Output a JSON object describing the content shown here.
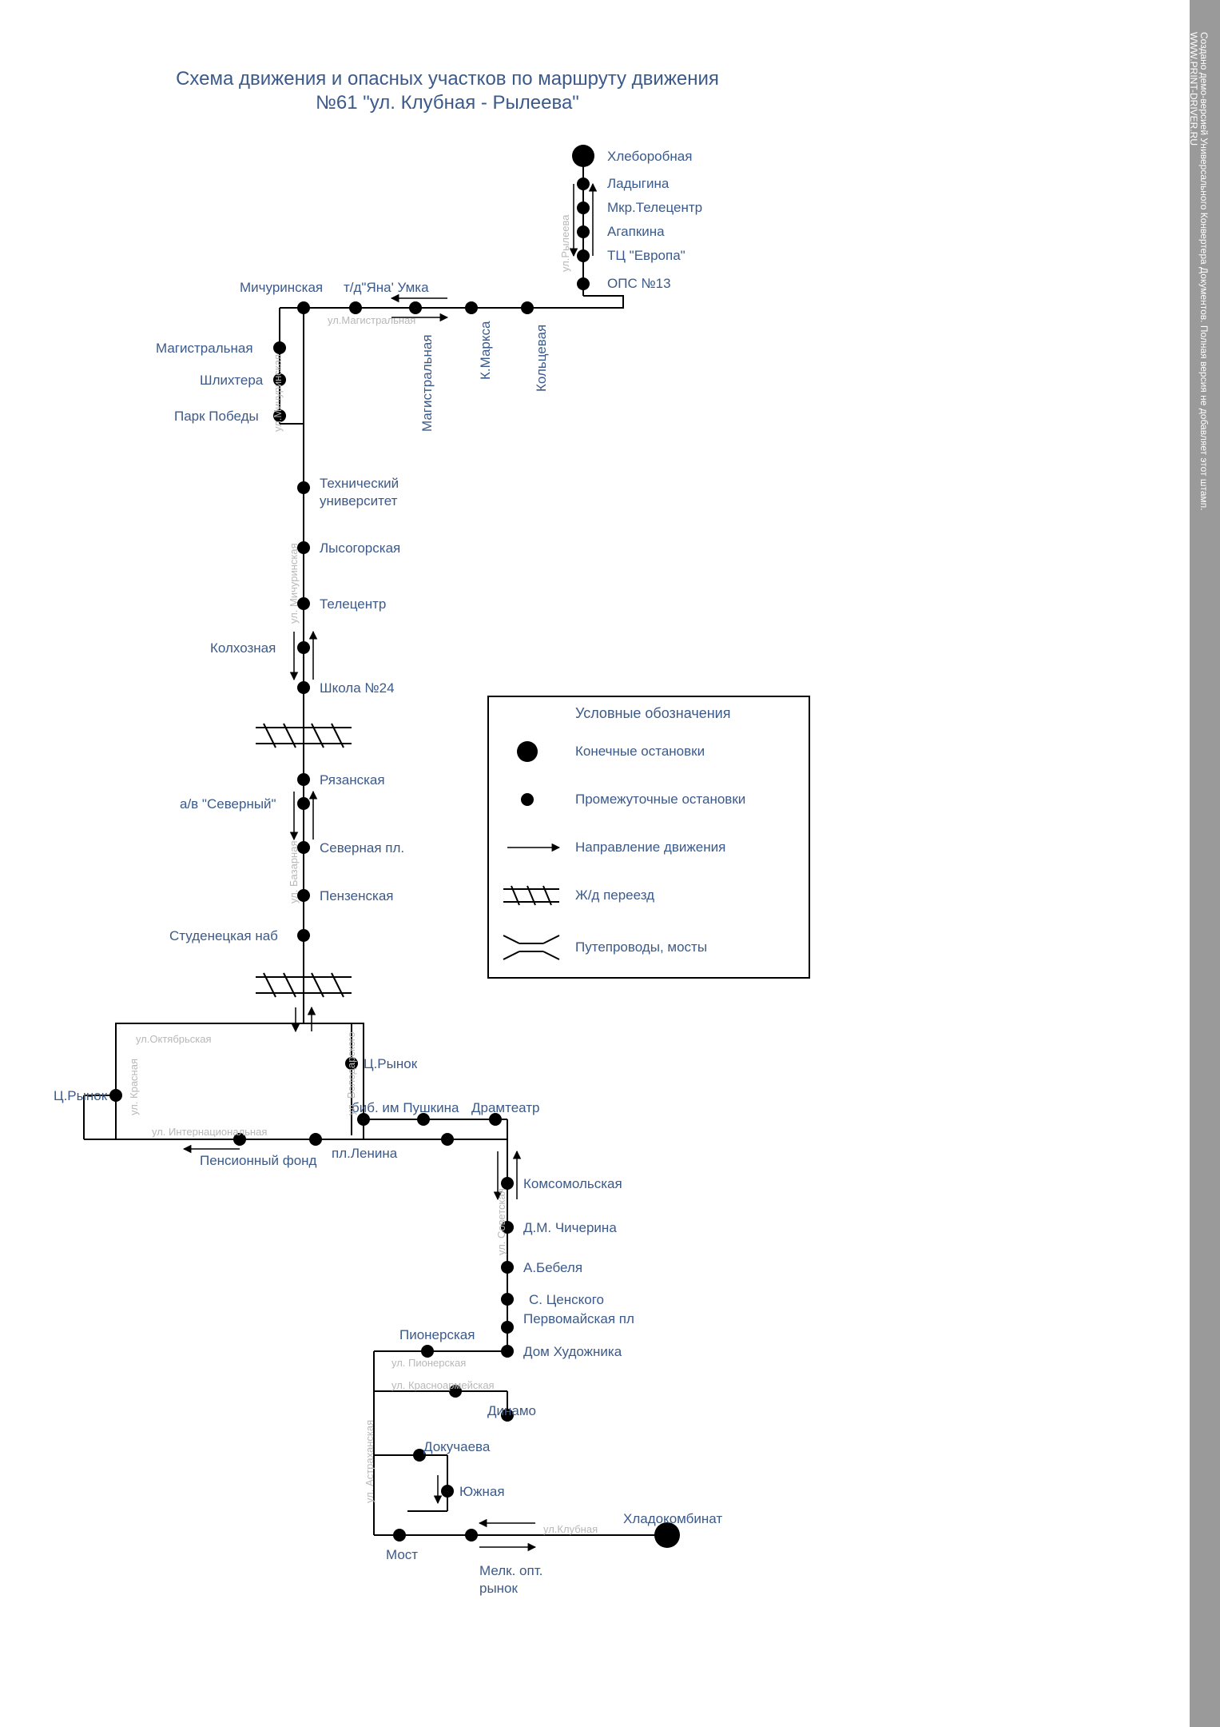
{
  "title_line1": "Схема движения и опасных участков по маршруту движения",
  "title_line2": "№61 \"ул. Клубная - Рылеева\"",
  "legend": {
    "title": "Условные обозначения",
    "terminal": "Конечные остановки",
    "intermediate": "Промежуточные остановки",
    "direction": "Направление движения",
    "railcross": "Ж/д переезд",
    "bridge": "Путепроводы, мосты"
  },
  "stops_right_top": [
    {
      "id": "hleborobnaya",
      "label": "Хлеборобная"
    },
    {
      "id": "ladygina",
      "label": "Ладыгина"
    },
    {
      "id": "mkr-telecentr",
      "label": "Мкр.Телецентр"
    },
    {
      "id": "agapkina",
      "label": "Агапкина"
    },
    {
      "id": "tc-evropa",
      "label": "ТЦ \"Европа\""
    },
    {
      "id": "ops13",
      "label": "ОПС №13"
    }
  ],
  "stops_top_row": [
    {
      "id": "michurinskaya",
      "label": "Мичуринская"
    },
    {
      "id": "td-yana-umka",
      "label": "т/д\"Яна' Умка"
    }
  ],
  "vertical_top_stops": [
    {
      "id": "magistralnaya-v",
      "label": "Магистральная"
    },
    {
      "id": "kmarksa-v",
      "label": "К.Маркса"
    },
    {
      "id": "koltsevaya-v",
      "label": "Кольцевая"
    }
  ],
  "left_stops": [
    {
      "id": "magistralnaya",
      "label": "Магистральная"
    },
    {
      "id": "shlihtera",
      "label": "Шлихтера"
    },
    {
      "id": "park-pobedy",
      "label": "Парк Победы"
    }
  ],
  "column_stops": [
    {
      "id": "tech-univ",
      "label": "Технический университет"
    },
    {
      "id": "lysogorskaya",
      "label": "Лысогорская"
    },
    {
      "id": "telecentr",
      "label": "Телецентр"
    },
    {
      "id": "kolhoznaya",
      "label": "Колхозная",
      "side": "left"
    },
    {
      "id": "school24",
      "label": "Школа №24"
    },
    {
      "id": "ryazanskaya",
      "label": "Рязанская"
    },
    {
      "id": "av-severny",
      "label": "а/в \"Северный\"",
      "side": "left"
    },
    {
      "id": "severnaya-pl",
      "label": "Северная пл."
    },
    {
      "id": "penzenskaya",
      "label": "Пензенская"
    },
    {
      "id": "studen-nab",
      "label": "Студенецкая наб",
      "side": "left"
    }
  ],
  "city_block": [
    {
      "id": "c-rynok-left",
      "label": "Ц.Рынок",
      "side": "left-out"
    },
    {
      "id": "c-rynok",
      "label": "Ц.Рынок"
    },
    {
      "id": "bib-pushkina",
      "label": "биб. им Пушкина"
    },
    {
      "id": "dramteatr",
      "label": "Драмтеатр"
    },
    {
      "id": "pension-fond",
      "label": "Пенсионный фонд"
    },
    {
      "id": "pl-lenina",
      "label": "пл.Ленина"
    }
  ],
  "south_stops": [
    {
      "id": "komsomolskaya",
      "label": "Комсомольская"
    },
    {
      "id": "chicherina",
      "label": "Д.М. Чичерина"
    },
    {
      "id": "bebelya",
      "label": "А.Бебеля"
    },
    {
      "id": "tsenskogo",
      "label": "С. Ценского"
    },
    {
      "id": "pervomay",
      "label": "Первомайская пл"
    },
    {
      "id": "dom-hud",
      "label": "Дом Художника"
    },
    {
      "id": "pionerskaya",
      "label": "Пионерская",
      "side": "left"
    },
    {
      "id": "dinamo",
      "label": "Динамо"
    },
    {
      "id": "dokuchaeva",
      "label": "Докучаева"
    },
    {
      "id": "yuzhnaya",
      "label": "Южная"
    },
    {
      "id": "most",
      "label": "Мост"
    },
    {
      "id": "hladokombinat",
      "label": "Хладокомбинат"
    },
    {
      "id": "melk-opt",
      "label": "Мелк. опт. рынок"
    }
  ],
  "streets": {
    "ryleeva": "ул.Рылеева",
    "magistralnaya": "ул.Магистральная",
    "michurinskaya": "ул.Мичуринская",
    "michurinskaya2": "ул. Мичуринская",
    "bazarnaya": "ул. Базарная",
    "oktyabrskaya": "ул.Октябрьская",
    "krasnaya": "ул. Красная",
    "internatsionalnaya": "ул. Интернациональная",
    "sovetskaya": "ул. Советская",
    "pionerskaya": "ул. Пионерская",
    "krasnoarmeyskaya": "ул. Красноармейская",
    "astrahanskaya": "ул. Астраханская",
    "klubnaya": "ул.Клубная",
    "volodarskogo": "ул. Володарского"
  },
  "watermark": "Создано демо-версией Универсального Конвертера Документов. Полная версия не добавляет этот штамп.",
  "watermark_url": "WWW.PRINT-DRIVER.RU"
}
